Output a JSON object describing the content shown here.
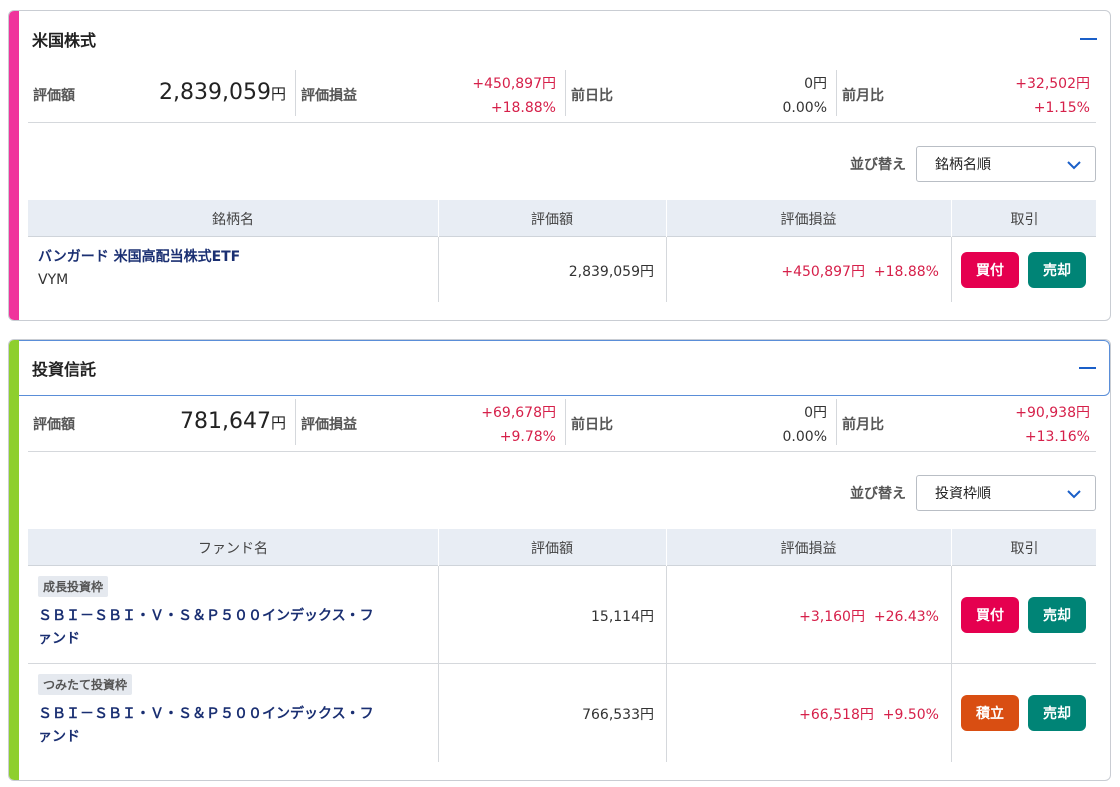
{
  "colors": {
    "us_accent": "#f0349c",
    "fund_accent": "#8ecf2e",
    "buy": "#e5004f",
    "sell": "#008476",
    "tsumitate": "#d94e12",
    "red": "#d6204a"
  },
  "us": {
    "title": "米国株式",
    "summary": {
      "valuation_label": "評価額",
      "valuation_value": "2,839,059",
      "yen": "円",
      "pl_label": "評価損益",
      "pl_amount": "+450,897円",
      "pl_pct": "+18.88%",
      "day_label": "前日比",
      "day_amount": "0円",
      "day_pct": "0.00%",
      "month_label": "前月比",
      "month_amount": "+32,502円",
      "month_pct": "+1.15%"
    },
    "sort_label": "並び替え",
    "sort_value": "銘柄名順",
    "headers": [
      "銘柄名",
      "評価額",
      "評価損益",
      "取引"
    ],
    "rows": [
      {
        "name": "バンガード 米国高配当株式ETF",
        "ticker": "VYM",
        "valuation": "2,839,059円",
        "pl_amount": "+450,897円",
        "pl_pct": "+18.88%",
        "buy": "買付",
        "sell": "売却"
      }
    ]
  },
  "fund": {
    "title": "投資信託",
    "summary": {
      "valuation_label": "評価額",
      "valuation_value": "781,647",
      "yen": "円",
      "pl_label": "評価損益",
      "pl_amount": "+69,678円",
      "pl_pct": "+9.78%",
      "day_label": "前日比",
      "day_amount": "0円",
      "day_pct": "0.00%",
      "month_label": "前月比",
      "month_amount": "+90,938円",
      "month_pct": "+13.16%"
    },
    "sort_label": "並び替え",
    "sort_value": "投資枠順",
    "headers": [
      "ファンド名",
      "評価額",
      "評価損益",
      "取引"
    ],
    "rows": [
      {
        "tag": "成長投資枠",
        "name_line1": "ＳＢＩ－ＳＢＩ・Ｖ・Ｓ＆Ｐ５００インデックス・フ",
        "name_line2": "ァンド",
        "valuation": "15,114円",
        "pl_amount": "+3,160円",
        "pl_pct": "+26.43%",
        "buy": "買付",
        "sell": "売却"
      },
      {
        "tag": "つみたて投資枠",
        "name_line1": "ＳＢＩ－ＳＢＩ・Ｖ・Ｓ＆Ｐ５００インデックス・フ",
        "name_line2": "ァンド",
        "valuation": "766,533円",
        "pl_amount": "+66,518円",
        "pl_pct": "+9.50%",
        "buy": "積立",
        "sell": "売却"
      }
    ]
  }
}
